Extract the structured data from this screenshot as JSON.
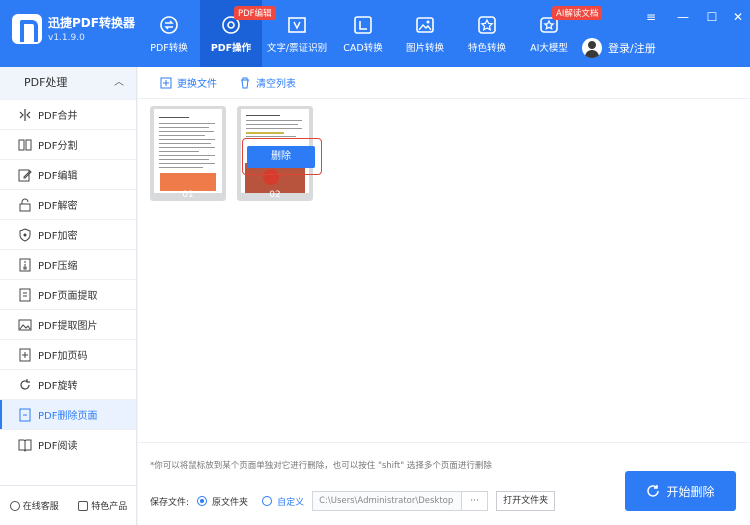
{
  "app": {
    "name": "迅捷PDF转换器",
    "version": "v1.1.9.0"
  },
  "nav": {
    "items": [
      {
        "label": "PDF转换",
        "icon": "convert-icon",
        "badge": ""
      },
      {
        "label": "PDF操作",
        "icon": "settings-icon",
        "badge": "PDF编辑",
        "active": true
      },
      {
        "label": "文字/票证识别",
        "icon": "scan-icon",
        "badge": ""
      },
      {
        "label": "CAD转换",
        "icon": "cad-icon",
        "badge": ""
      },
      {
        "label": "图片转换",
        "icon": "image-icon",
        "badge": ""
      },
      {
        "label": "特色转换",
        "icon": "star-icon",
        "badge": ""
      },
      {
        "label": "AI大模型",
        "icon": "ai-icon",
        "badge": "AI解读文档"
      }
    ]
  },
  "user": {
    "label": "登录/注册"
  },
  "window": {
    "menu": "≡",
    "minimize": "—",
    "maximize": "☐",
    "close": "✕"
  },
  "sidebar": {
    "title": "PDF处理",
    "items": [
      {
        "label": "PDF合并",
        "icon": "merge-icon"
      },
      {
        "label": "PDF分割",
        "icon": "split-icon"
      },
      {
        "label": "PDF编辑",
        "icon": "edit-icon"
      },
      {
        "label": "PDF解密",
        "icon": "unlock-icon"
      },
      {
        "label": "PDF加密",
        "icon": "shield-icon"
      },
      {
        "label": "PDF压缩",
        "icon": "compress-icon"
      },
      {
        "label": "PDF页面提取",
        "icon": "extract-page-icon"
      },
      {
        "label": "PDF提取图片",
        "icon": "extract-image-icon"
      },
      {
        "label": "PDF加页码",
        "icon": "page-number-icon"
      },
      {
        "label": "PDF旋转",
        "icon": "rotate-icon"
      },
      {
        "label": "PDF删除页面",
        "icon": "delete-page-icon",
        "active": true
      },
      {
        "label": "PDF阅读",
        "icon": "book-icon"
      }
    ],
    "bottom": {
      "service": "在线客服",
      "products": "特色产品"
    }
  },
  "toolbar": {
    "replace": "更换文件",
    "clear": "清空列表"
  },
  "pages": [
    {
      "number": "01"
    },
    {
      "number": "02",
      "delete_label": "删除"
    }
  ],
  "hint": "*你可以将鼠标放到某个页面单独对它进行删除，也可以按住 \"shift\" 选择多个页面进行删除",
  "save": {
    "label": "保存文件:",
    "option_original": "原文件夹",
    "option_custom": "自定义",
    "path": "C:\\Users\\Administrator\\Desktop",
    "browse": "···",
    "open_folder": "打开文件夹"
  },
  "start_button": "开始删除",
  "colors": {
    "primary": "#2d7cf6",
    "nav_active": "#1b62d8",
    "badge": "#f0483e",
    "highlight_frame": "#e0453a"
  }
}
